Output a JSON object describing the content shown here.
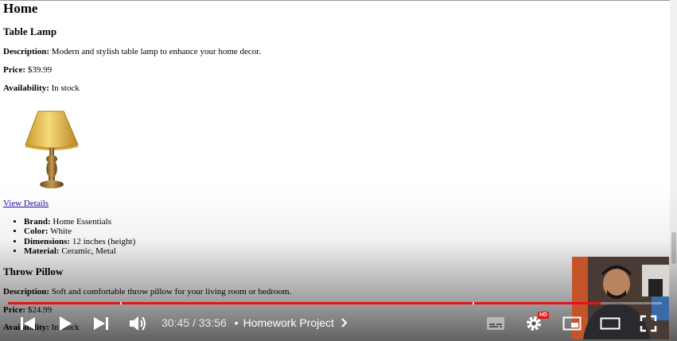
{
  "page": {
    "heading": "Home",
    "products": [
      {
        "name": "Table Lamp",
        "description_label": "Description:",
        "description": "Modern and stylish table lamp to enhance your home decor.",
        "price_label": "Price:",
        "price": "$39.99",
        "availability_label": "Availability:",
        "availability": "In stock",
        "details_link": "View Details",
        "specs": [
          {
            "label": "Brand:",
            "value": "Home Essentials"
          },
          {
            "label": "Color:",
            "value": "White"
          },
          {
            "label": "Dimensions:",
            "value": "12 inches (height)"
          },
          {
            "label": "Material:",
            "value": "Ceramic, Metal"
          }
        ]
      },
      {
        "name": "Throw Pillow",
        "description_label": "Description:",
        "description": "Soft and comfortable throw pillow for your living room or bedroom.",
        "price_label": "Price:",
        "price": "$24.99",
        "availability_label": "Availability:",
        "availability": "In stock"
      }
    ]
  },
  "player": {
    "current_time": "30:45",
    "separator": "/",
    "duration": "33:56",
    "chapter_bullet": "•",
    "chapter_title": "Homework Project",
    "hd_badge": "HD",
    "progress_fraction": 0.906,
    "colors": {
      "progress": "#e8121a",
      "hd": "#e8121a"
    },
    "icons": [
      "previous-icon",
      "play-icon",
      "next-icon",
      "volume-icon",
      "chevron-right-icon",
      "subtitles-icon",
      "settings-icon",
      "miniplayer-icon",
      "theater-icon",
      "fullscreen-icon"
    ]
  }
}
